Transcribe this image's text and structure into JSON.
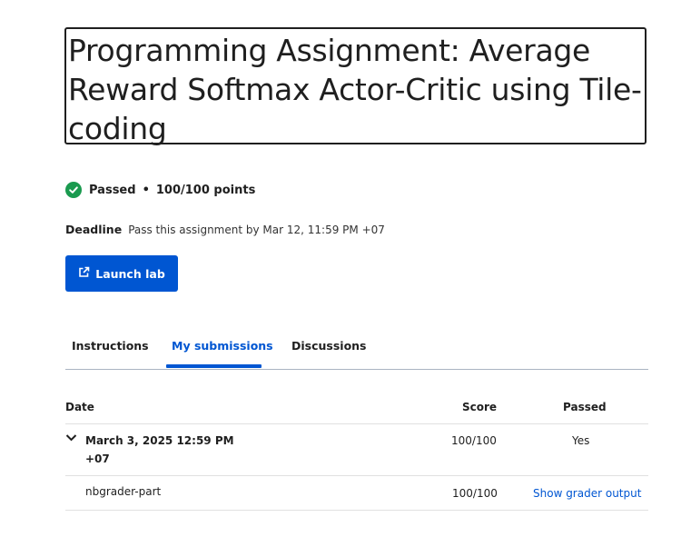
{
  "page": {
    "title": "Programming Assignment: Average Reward Softmax Actor-Critic using Tile-coding",
    "status": "Passed",
    "points": "100/100 points",
    "deadline_label": "Deadline",
    "deadline_text": "Pass this assignment by Mar 12, 11:59 PM +07"
  },
  "actions": {
    "launch_label": "Launch lab"
  },
  "tabs": [
    {
      "label": "Instructions"
    },
    {
      "label": "My submissions"
    },
    {
      "label": "Discussions"
    }
  ],
  "table": {
    "headers": {
      "date": "Date",
      "score": "Score",
      "passed": "Passed"
    },
    "submission": {
      "date_line1": "March 3, 2025 12:59 PM",
      "date_line2": "+07",
      "score": "100/100",
      "passed": "Yes"
    },
    "part": {
      "name": "nbgrader-part",
      "score": "100/100",
      "link": "Show grader output"
    }
  },
  "colors": {
    "accent": "#0056d2",
    "success": "#1a9a4f"
  },
  "icons": [
    "check-circle-icon",
    "external-link-icon",
    "chevron-down-icon"
  ]
}
